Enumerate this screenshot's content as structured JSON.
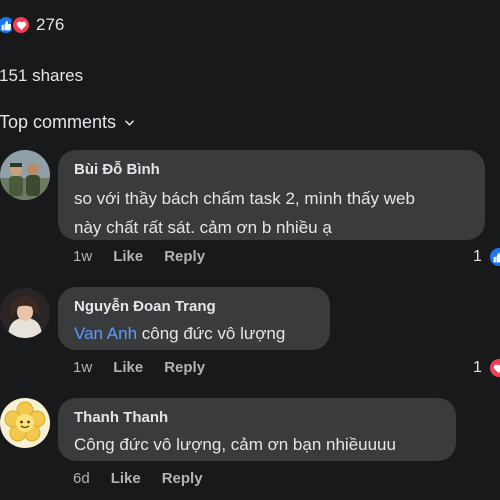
{
  "reactions": {
    "count": "276",
    "icons": [
      "like-icon",
      "love-icon"
    ],
    "like_color": "#1877f2",
    "love_color": "#f33e58"
  },
  "shares": {
    "text": "151 shares"
  },
  "sort": {
    "label": "Top comments"
  },
  "comments": [
    {
      "author": "Bùi Đỗ Bình",
      "line1": "so với thầy bách chấm task 2, mình thấy web",
      "line2": "này chất rất sát. cảm ơn b nhiều ạ",
      "time": "1w",
      "like": "Like",
      "reply": "Reply",
      "reaction_count": "1",
      "reaction": "like-icon"
    },
    {
      "author": "Nguyễn Đoan Trang",
      "mention": "Van Anh",
      "text": " công đức vô lượng",
      "time": "1w",
      "like": "Like",
      "reply": "Reply",
      "reaction_count": "1",
      "reaction": "love-icon"
    },
    {
      "author": "Thanh Thanh",
      "text": "Công đức vô lượng, cảm ơn bạn nhiềuuuu",
      "time": "6d",
      "like": "Like",
      "reply": "Reply"
    }
  ]
}
